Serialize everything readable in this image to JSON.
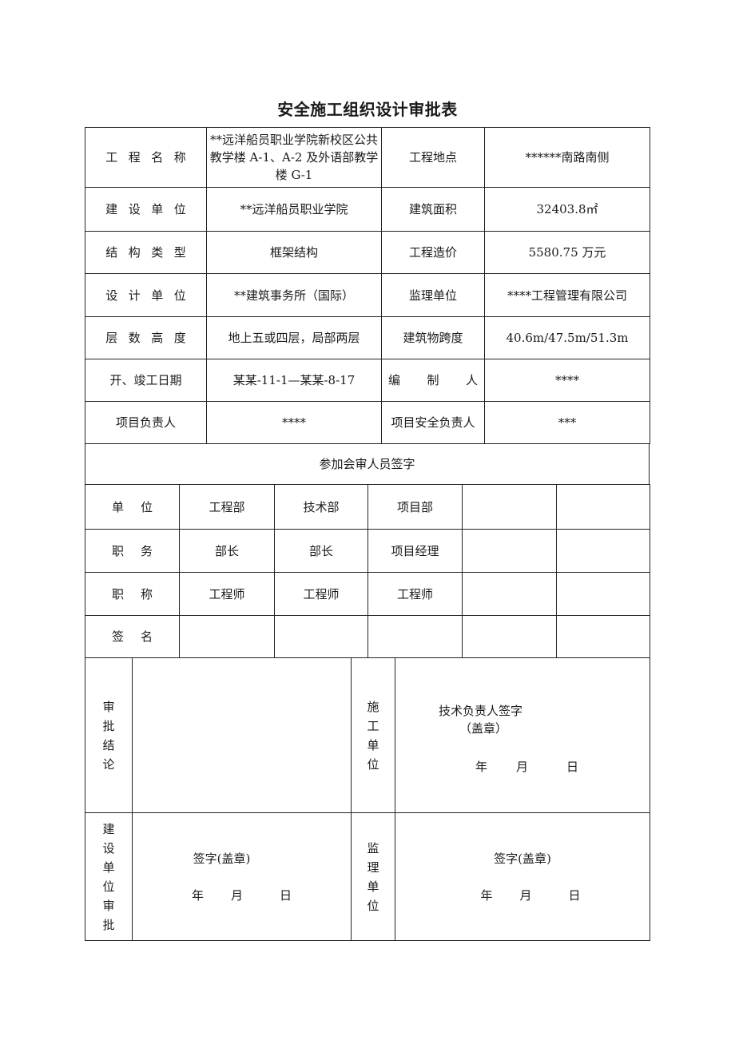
{
  "title": "安全施工组织设计审批表",
  "info_rows": [
    {
      "label1": "工程名称",
      "value1": "**远洋船员职业学院新校区公共教学楼 A-1、A-2 及外语部教学楼 G-1",
      "label2": "工程地点",
      "value2": "******南路南侧"
    },
    {
      "label1": "建设单位",
      "value1": "**远洋船员职业学院",
      "label2": "建筑面积",
      "value2": "32403.8㎡"
    },
    {
      "label1": "结构类型",
      "value1": "框架结构",
      "label2": "工程造价",
      "value2": "5580.75 万元"
    },
    {
      "label1": "设计单位",
      "value1": "**建筑事务所（国际）",
      "label2": "监理单位",
      "value2": "****工程管理有限公司"
    },
    {
      "label1": "层数高度",
      "value1": "地上五或四层，局部两层",
      "label2": "建筑物跨度",
      "value2": "40.6m/47.5m/51.3m"
    },
    {
      "label1": "开、竣工日期",
      "value1": "某某-11-1—某某-8-17",
      "label2_chars": [
        "编",
        "制",
        "人"
      ],
      "value2": "****"
    },
    {
      "label1": "项目负责人",
      "value1": "****",
      "label2": "项目安全负责人",
      "value2": "***"
    }
  ],
  "review_header": "参加会审人员签字",
  "review_rows": [
    {
      "label": "单位",
      "cells": [
        "工程部",
        "技术部",
        "项目部",
        "",
        ""
      ]
    },
    {
      "label": "职务",
      "cells": [
        "部长",
        "部长",
        "项目经理",
        "",
        ""
      ]
    },
    {
      "label": "职称",
      "cells": [
        "工程师",
        "工程师",
        "工程师",
        "",
        ""
      ]
    },
    {
      "label": "签名",
      "cells": [
        "",
        "",
        "",
        "",
        ""
      ]
    }
  ],
  "approval": {
    "conclusion_label": [
      "审",
      "批",
      "结",
      "论"
    ],
    "conclusion_value": "",
    "contractor_label": [
      "施",
      "工",
      "单",
      "位"
    ],
    "contractor_sign": "技术负责人签字",
    "contractor_stamp": "（盖章）",
    "date": [
      "年",
      "月",
      "日"
    ],
    "owner_label": [
      "建",
      "设",
      "单",
      "位",
      "审",
      "批"
    ],
    "owner_sign": "签字(盖章)",
    "supervisor_label": [
      "监",
      "理",
      "单",
      "位"
    ],
    "supervisor_sign": "签字(盖章)"
  }
}
